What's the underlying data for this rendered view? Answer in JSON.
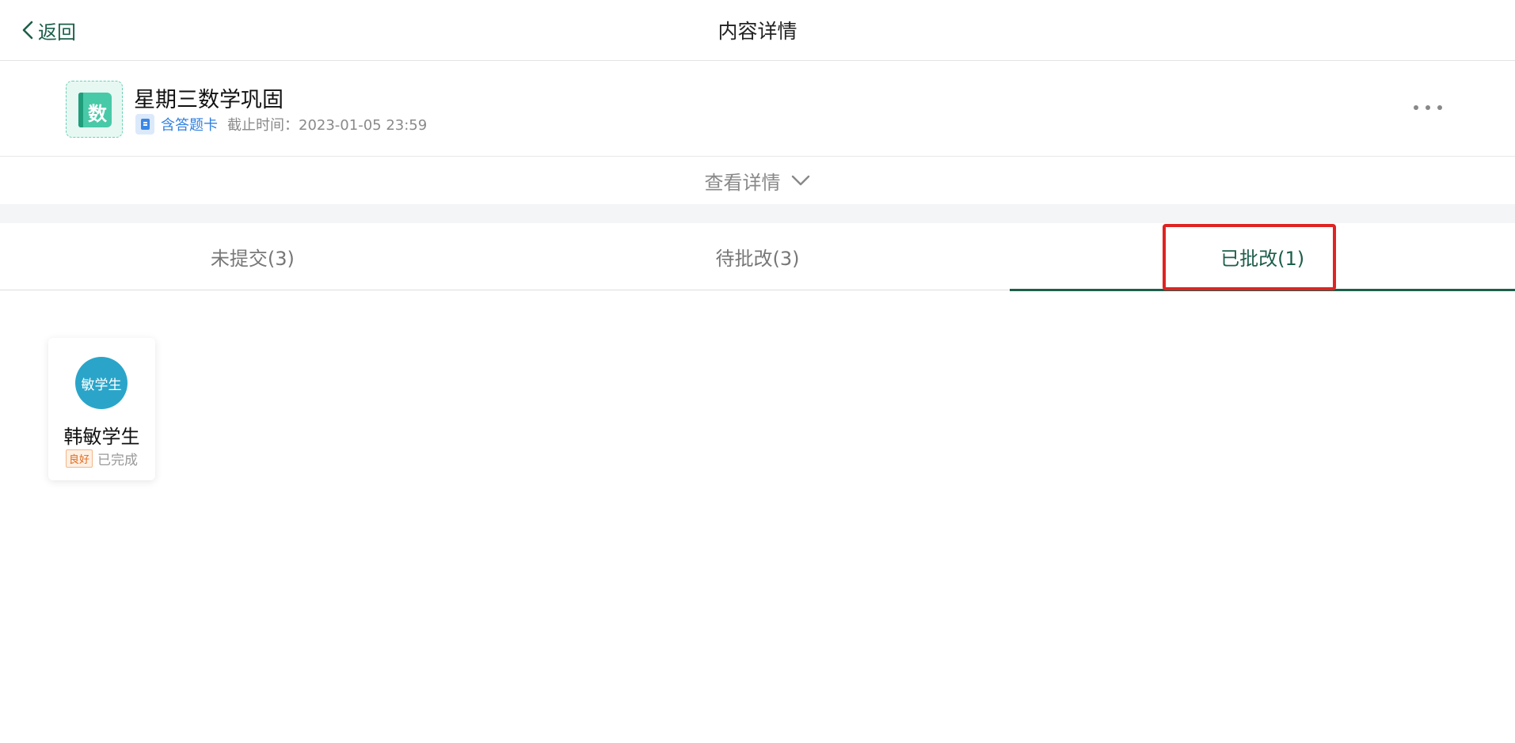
{
  "header": {
    "back_label": "返回",
    "title": "内容详情"
  },
  "task": {
    "subject_char": "数",
    "title": "星期三数学巩固",
    "has_answer_card": "含答题卡",
    "deadline": "截止时间：2023-01-05 23:59"
  },
  "details": {
    "label": "查看详情"
  },
  "tabs": [
    {
      "label": "未提交(3)",
      "active": false
    },
    {
      "label": "待批改(3)",
      "active": false
    },
    {
      "label": "已批改(1)",
      "active": true
    }
  ],
  "students": [
    {
      "avatar_text": "敏学生",
      "name": "韩敏学生",
      "grade": "良好",
      "status": "已完成"
    }
  ],
  "colors": {
    "accent": "#1d5e4b",
    "highlight": "#e02323",
    "avatar": "#2aa5c9",
    "link": "#2f7fe0"
  }
}
